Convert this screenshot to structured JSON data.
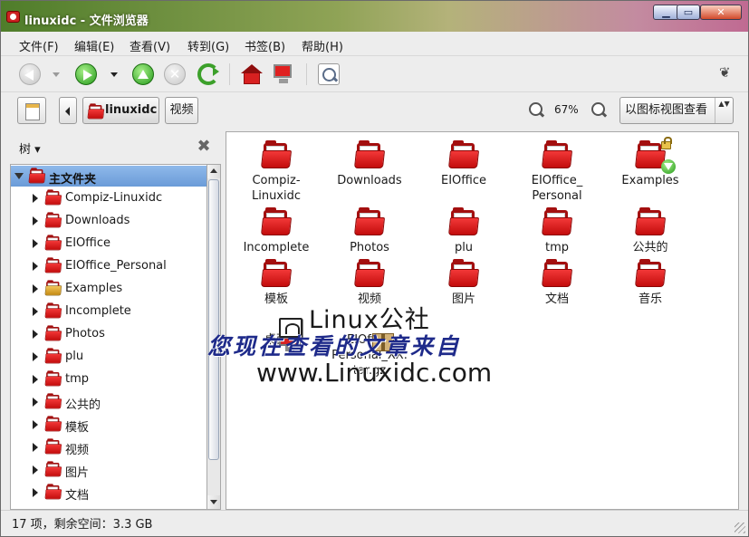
{
  "window": {
    "title": "linuxidc - 文件浏览器",
    "min": "▁",
    "max": "▭",
    "close": "✕"
  },
  "menu": [
    "文件(F)",
    "编辑(E)",
    "查看(V)",
    "转到(G)",
    "书签(B)",
    "帮助(H)"
  ],
  "toolbar": {
    "icons": [
      "back-icon",
      "forward-icon",
      "up-icon",
      "stop-icon",
      "reload-icon",
      "home-icon",
      "computer-icon",
      "search-icon"
    ],
    "stop_glyph": "✕",
    "foot_glyph": "❦"
  },
  "location": {
    "path": [
      "linuxidc",
      "视频"
    ],
    "zoom": "67%",
    "view_mode": "以图标视图查看",
    "view_arrows": "▲▼"
  },
  "sidebar": {
    "title": "树",
    "title_arrow": "▾",
    "close_glyph": "✖",
    "root": "主文件夹",
    "items": [
      "Compiz-Linuxidc",
      "Downloads",
      "EIOffice",
      "EIOffice_Personal",
      "Examples",
      "Incomplete",
      "Photos",
      "plu",
      "tmp",
      "公共的",
      "模板",
      "视频",
      "图片",
      "文档"
    ]
  },
  "files": [
    {
      "name": "Compiz-\nLinuxidc",
      "line1": "Compiz-",
      "line2": "Linuxidc"
    },
    {
      "line1": "Downloads",
      "line2": ""
    },
    {
      "line1": "EIOffice",
      "line2": ""
    },
    {
      "line1": "EIOffice_",
      "line2": "Personal"
    },
    {
      "line1": "Examples",
      "line2": ""
    },
    {
      "line1": "Incomplete",
      "line2": ""
    },
    {
      "line1": "Photos",
      "line2": ""
    },
    {
      "line1": "plu",
      "line2": ""
    },
    {
      "line1": "tmp",
      "line2": ""
    },
    {
      "line1": "公共的",
      "line2": ""
    },
    {
      "line1": "模板",
      "line2": ""
    },
    {
      "line1": "视频",
      "line2": ""
    },
    {
      "line1": "图片",
      "line2": ""
    },
    {
      "line1": "文档",
      "line2": ""
    },
    {
      "line1": "音乐",
      "line2": ""
    },
    {
      "line1": "桌面",
      "line2": ""
    },
    {
      "line1": "EIOffice",
      "line2": "Personal_XX.",
      "line3": "tar.gz"
    }
  ],
  "watermark": {
    "line1": "Linux公社",
    "line2": "您现在查看的文章来自",
    "line3": "www.Linuxidc.com"
  },
  "status": "17 项，剩余空间：3.3 GB"
}
